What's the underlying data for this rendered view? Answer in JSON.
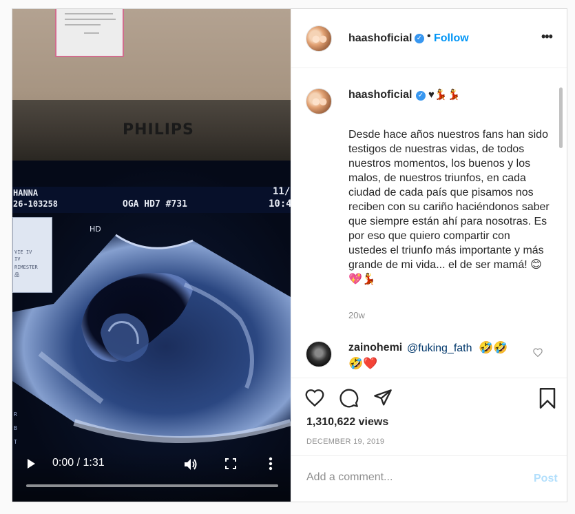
{
  "post": {
    "username": "haashoficial",
    "follow_label": "Follow",
    "separator": "•",
    "caption_emoji": "♥💃💃",
    "caption": "Desde hace años nuestros fans han sido testigos de nuestras vidas, de todos nuestros momentos, los buenos y los malos, de nuestros triunfos, en cada ciudad de cada país que pisamos nos reciben con su cariño haciéndonos saber que siempre están ahí para nosotras. Es por eso que quiero compartir con ustedes el triunfo más importante y más grande de mi vida... el de ser mamá! 😊💖💃",
    "age": "20w",
    "views": "1,310,622 views",
    "date": "December 19, 2019"
  },
  "comment": {
    "username": "zainohemi",
    "mention": "@fuking_fath",
    "emoji_a": "🤣🤣",
    "emoji_b": "🤣❤️"
  },
  "video": {
    "monitor_brand": "PHILIPS",
    "scan_name": "HANNA",
    "scan_id": "26-103258",
    "scan_mode": "OGA  HD7 #731",
    "scan_date": "11/",
    "scan_time": "10:4",
    "hd_label": "HD",
    "panel_lines": [
      "VIE IV",
      "IV",
      "RIMESTER",
      "品"
    ],
    "timecode": "0:00 / 1:31",
    "progress": 0.0
  },
  "add_comment": {
    "placeholder": "Add a comment...",
    "post_label": "Post"
  },
  "colors": {
    "accent": "#0095f6",
    "verified": "#3897f0",
    "muted": "#8e8e8e",
    "post_disabled": "#b2dffc"
  }
}
